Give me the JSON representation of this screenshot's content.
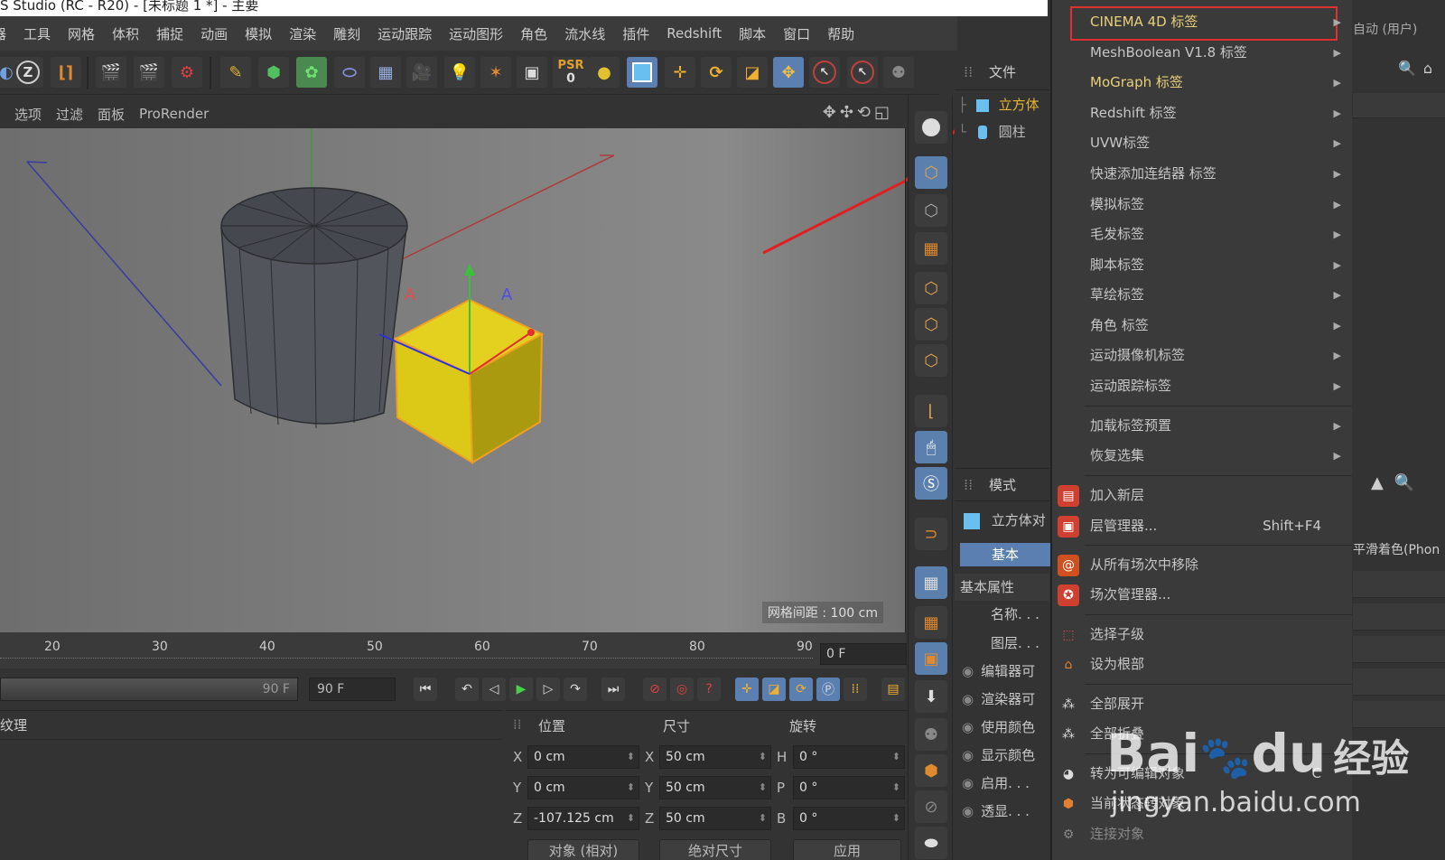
{
  "window": {
    "title": "S Studio (RC - R20) - [未标题 1 *] - 主要"
  },
  "menubar": [
    "器",
    "工具",
    "网格",
    "体积",
    "捕捉",
    "动画",
    "模拟",
    "渲染",
    "雕刻",
    "运动跟踪",
    "运动图形",
    "角色",
    "流水线",
    "插件",
    "Redshift",
    "脚本",
    "窗口",
    "帮助"
  ],
  "toolbar": {
    "psr_label": "PSR",
    "psr_value": "0"
  },
  "viewport": {
    "menu": [
      "选项",
      "过滤",
      "面板",
      "ProRender"
    ],
    "grid_spacing": "网格间距 : 100 cm"
  },
  "timeline": {
    "ticks": [
      "20",
      "30",
      "40",
      "50",
      "60",
      "70",
      "80",
      "90"
    ],
    "current_frame": "0 F",
    "end_frame_a": "90 F",
    "end_frame_b": "90 F"
  },
  "material_panel": {
    "title": "纹理"
  },
  "coords": {
    "headers": {
      "position": "位置",
      "size": "尺寸",
      "rotation": "旋转"
    },
    "rows": [
      {
        "pl": "X",
        "pv": "0 cm",
        "sl": "X",
        "sv": "50 cm",
        "rl": "H",
        "rv": "0 °"
      },
      {
        "pl": "Y",
        "pv": "0 cm",
        "sl": "Y",
        "sv": "50 cm",
        "rl": "P",
        "rv": "0 °"
      },
      {
        "pl": "Z",
        "pv": "-107.125 cm",
        "sl": "Z",
        "sv": "50 cm",
        "rl": "B",
        "rv": "0 °"
      }
    ],
    "buttons": {
      "object_mode": "对象 (相对)",
      "size_mode": "绝对尺寸",
      "apply": "应用"
    }
  },
  "object_manager": {
    "title": "文件",
    "objects": [
      {
        "name": "立方体",
        "selected": true
      },
      {
        "name": "圆柱",
        "selected": false
      }
    ]
  },
  "attribute_manager": {
    "title": "模式",
    "object": "立方体对",
    "tab": "基本",
    "section": "基本属性",
    "fields": [
      "名称. . .",
      "图层. . ."
    ],
    "checks": [
      "编辑器可",
      "渲染器可",
      "使用颜色",
      "显示颜色",
      "启用. . .",
      "透显. . ."
    ]
  },
  "context_menu": {
    "items": [
      {
        "label": "CINEMA 4D 标签",
        "sub": true,
        "highlight": true
      },
      {
        "label": "MeshBoolean V1.8 标签",
        "sub": true
      },
      {
        "label": "MoGraph 标签",
        "sub": true,
        "bright": true
      },
      {
        "label": "Redshift 标签",
        "sub": true
      },
      {
        "label": "UVW标签",
        "sub": true
      },
      {
        "label": "快速添加连结器 标签",
        "sub": true
      },
      {
        "label": "模拟标签",
        "sub": true
      },
      {
        "label": "毛发标签",
        "sub": true
      },
      {
        "label": "脚本标签",
        "sub": true
      },
      {
        "label": "草绘标签",
        "sub": true
      },
      {
        "label": "角色 标签",
        "sub": true
      },
      {
        "label": "运动摄像机标签",
        "sub": true
      },
      {
        "label": "运动跟踪标签",
        "sub": true
      }
    ],
    "items2": [
      {
        "label": "加载标签预置",
        "sub": true
      },
      {
        "label": "恢复选集",
        "sub": true
      }
    ],
    "items3": [
      {
        "label": "加入新层",
        "icon": "layer-add"
      },
      {
        "label": "层管理器...",
        "icon": "layer-manager",
        "shortcut": "Shift+F4"
      }
    ],
    "items4": [
      {
        "label": "从所有场次中移除",
        "icon": "take-remove"
      },
      {
        "label": "场次管理器...",
        "icon": "take-manager"
      }
    ],
    "items5": [
      {
        "label": "选择子级",
        "icon": "select-children"
      },
      {
        "label": "设为根部",
        "icon": "set-root"
      }
    ],
    "items6": [
      {
        "label": "全部展开",
        "icon": "expand-all"
      },
      {
        "label": "全部折叠",
        "icon": "collapse-all"
      }
    ],
    "items7": [
      {
        "label": "转为可编辑对象",
        "icon": "make-editable",
        "shortcut": "C"
      },
      {
        "label": "当前状态转对象",
        "icon": "current-state"
      },
      {
        "label": "连接对象",
        "icon": "connect-objects"
      }
    ]
  },
  "right_strip": {
    "top_label": "自动 (用户)",
    "shading": "平滑着色(Phon"
  },
  "watermark": {
    "brand_a": "Bai",
    "brand_b": "du",
    "brand_c": "经验",
    "url": "jingyan.baidu.com"
  },
  "colors": {
    "highlight_box": "#e03030",
    "accent_blue": "#5a7fb0",
    "cube_yellow": "#e2cc1c",
    "cylinder": "#50535a"
  }
}
